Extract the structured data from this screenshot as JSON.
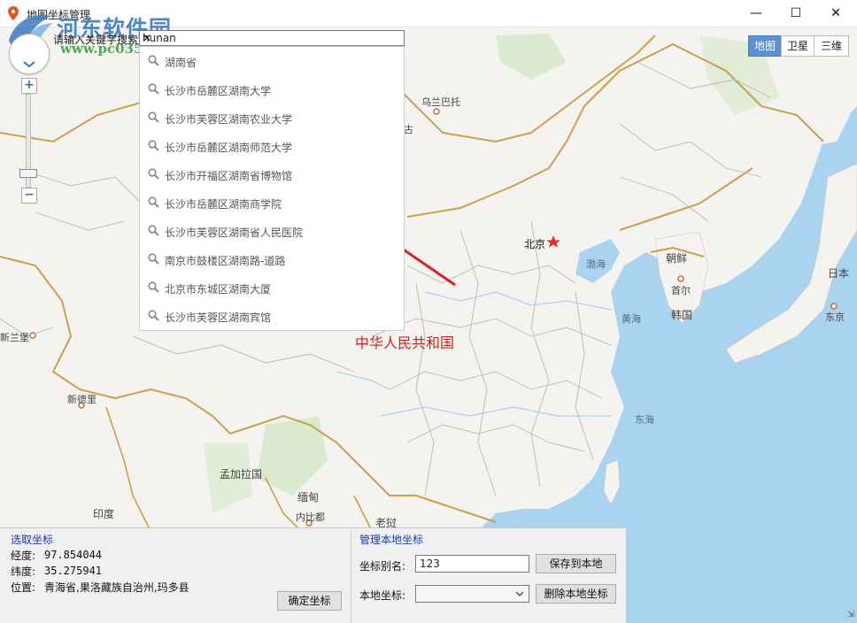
{
  "window": {
    "title": "地图坐标管理",
    "controls": {
      "minimize": "—",
      "maximize": "☐",
      "close": "✕"
    }
  },
  "watermark": {
    "site_name": "河东软件园",
    "url": "www.pc0359.cn"
  },
  "search": {
    "label": "请输入关键字搜索",
    "value": "hunan",
    "clear": "✕",
    "suggestions": [
      "湖南省",
      "长沙市岳麓区湖南大学",
      "长沙市芙蓉区湖南农业大学",
      "长沙市岳麓区湖南师范大学",
      "长沙市开福区湖南省博物馆",
      "长沙市岳麓区湖南商学院",
      "长沙市芙蓉区湖南省人民医院",
      "南京市鼓楼区湖南路-道路",
      "北京市东城区湖南大厦",
      "长沙市芙蓉区湖南宾馆"
    ]
  },
  "zoom": {
    "plus": "+",
    "minus": "−"
  },
  "map_type": {
    "tabs": [
      "地图",
      "卫星",
      "三维"
    ],
    "active": "地图"
  },
  "map": {
    "country_label": "中华人民共和国",
    "labels": {
      "wulanbatuo": "乌兰巴托",
      "gu": "古",
      "beijing": "北京",
      "bohai": "渤海",
      "chaoxian": "朝鲜",
      "shouer": "首尔",
      "hanguo": "韩国",
      "riben": "日本",
      "dongjing": "东京",
      "huanghai": "黄海",
      "donghai": "东海",
      "xinlanbao": "新兰堡",
      "xindeli": "新德里",
      "mengjiala": "孟加拉国",
      "miandian": "缅甸",
      "yindu": "印度",
      "neibidu": "内比都",
      "laowo": "老挝"
    },
    "colors": {
      "land": "#f5f3f0",
      "water": "#aad3f0",
      "border": "#c9a04c",
      "province": "#b8b8b8",
      "arrow": "#e02020"
    }
  },
  "picked": {
    "title": "选取坐标",
    "lng_label": "经度:",
    "lng_value": "97.854044",
    "lat_label": "纬度:",
    "lat_value": "35.275941",
    "pos_label": "位置:",
    "pos_value": "青海省,果洛藏族自治州,玛多县",
    "confirm": "确定坐标"
  },
  "manage": {
    "title": "管理本地坐标",
    "alias_label": "坐标别名:",
    "alias_value": "123",
    "save": "保存到本地",
    "local_label": "本地坐标:",
    "local_value": "",
    "delete": "删除本地坐标"
  }
}
